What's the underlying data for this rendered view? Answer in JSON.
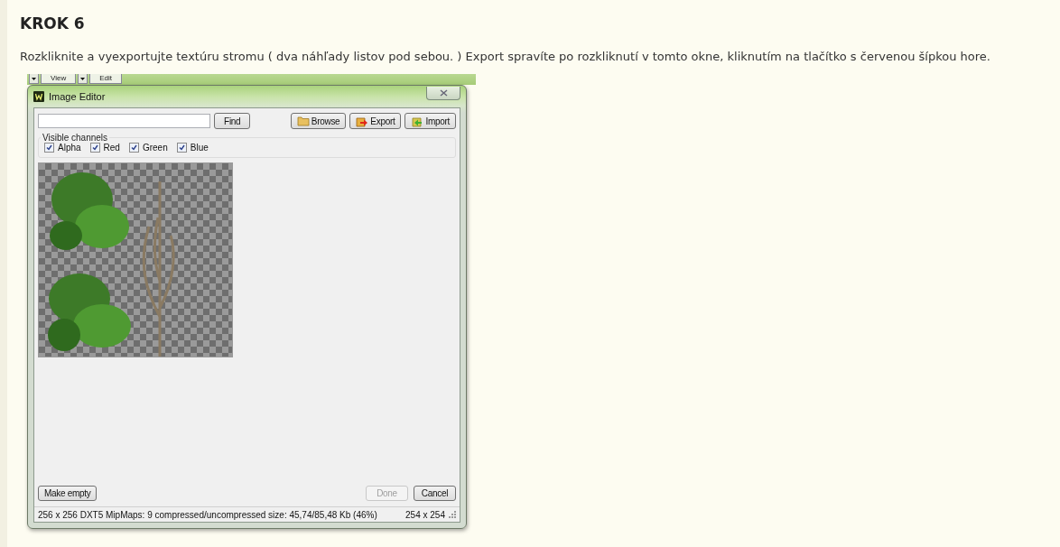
{
  "heading": "KROK 6",
  "instruction": "Rozkliknite a vyexportujte textúru stromu ( dva náhľady listov pod sebou. ) Export spravíte po rozkliknutí v tomto okne, kliknutím na tlačítko s červenou šípkou hore.",
  "background_toolbar": {
    "items": [
      "View",
      "Edit"
    ]
  },
  "window": {
    "title": "Image Editor",
    "toolbar_buttons": [
      {
        "label": "Find",
        "kind": "plain"
      },
      {
        "label": "Browse",
        "kind": "browse"
      },
      {
        "label": "Export",
        "kind": "export"
      },
      {
        "label": "Import",
        "kind": "import"
      }
    ],
    "visible_channels": {
      "label": "Visible channels",
      "channels": [
        {
          "label": "Alpha",
          "checked": true
        },
        {
          "label": "Red",
          "checked": true
        },
        {
          "label": "Green",
          "checked": true
        },
        {
          "label": "Blue",
          "checked": true
        }
      ]
    },
    "footer_buttons": [
      {
        "label": "Make empty",
        "disabled": false
      },
      {
        "label": "Done",
        "disabled": true
      },
      {
        "label": "Cancel",
        "disabled": false
      }
    ],
    "status_bar": {
      "info": "256 x 256 DXT5 MipMaps: 9 compressed/uncompressed size: 45,74/85,48 Kb (46%)",
      "dimensions": "254 x 254"
    }
  }
}
